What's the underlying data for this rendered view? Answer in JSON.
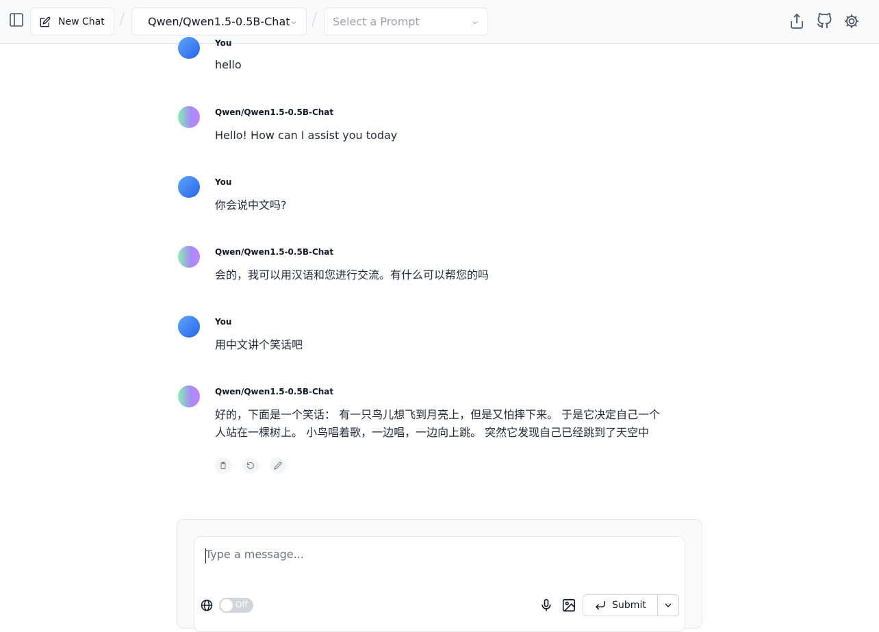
{
  "header": {
    "new_chat_label": "New Chat",
    "separator": "/",
    "model": "Qwen/Qwen1.5-0.5B-Chat",
    "prompt_placeholder": "Select a Prompt",
    "icons": [
      "sidebar-icon",
      "share-icon",
      "github-icon",
      "settings-icon"
    ]
  },
  "messages": [
    {
      "sender": "You",
      "role": "user",
      "text": "hello"
    },
    {
      "sender": "Qwen/Qwen1.5-0.5B-Chat",
      "role": "assistant",
      "text": "Hello! How can I assist you today"
    },
    {
      "sender": "You",
      "role": "user",
      "text": "你会说中文吗?"
    },
    {
      "sender": "Qwen/Qwen1.5-0.5B-Chat",
      "role": "assistant",
      "text": "会的，我可以用汉语和您进行交流。有什么可以帮您的吗"
    },
    {
      "sender": "You",
      "role": "user",
      "text": "用中文讲个笑话吧"
    },
    {
      "sender": "Qwen/Qwen1.5-0.5B-Chat",
      "role": "assistant",
      "text": "好的，下面是一个笑话： 有一只鸟儿想飞到月亮上，但是又怕摔下来。 于是它决定自己一个人站在一棵树上。 小鸟唱着歌，一边唱，一边向上跳。 突然它发现自己已经跳到了天空中"
    }
  ],
  "composer": {
    "placeholder": "Type a message...",
    "value": "",
    "web_toggle_state": "Off",
    "submit_label": "Submit"
  },
  "colors": {
    "user_avatar": "#3b82f6",
    "bot_avatar_start": "#86efac",
    "bot_avatar_end": "#c084fc",
    "header_bg": "#f9fafb"
  }
}
